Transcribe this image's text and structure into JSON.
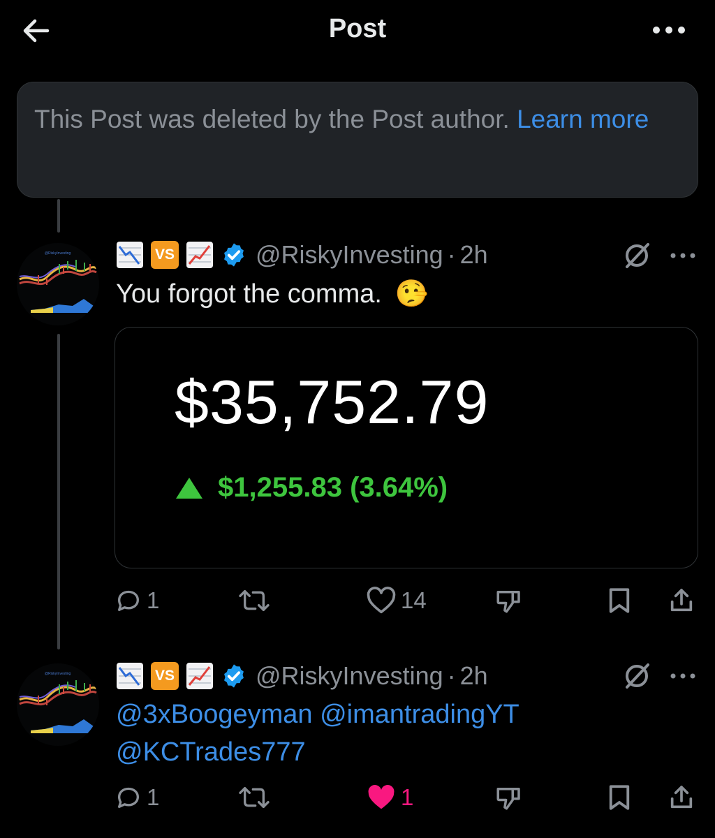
{
  "header": {
    "title": "Post"
  },
  "notice": {
    "text": "This Post was deleted by the Post author. ",
    "link": "Learn more"
  },
  "posts": [
    {
      "handle": "@RiskyInvesting",
      "sep": "·",
      "time": "2h",
      "badge": "VS",
      "text": "You forgot the comma.",
      "emoji": "🤥",
      "card": {
        "price": "$35,752.79",
        "change": "$1,255.83 (3.64%)"
      },
      "replies": "1",
      "reposts": "",
      "likes": "14",
      "liked": false
    },
    {
      "handle": "@RiskyInvesting",
      "sep": "·",
      "time": "2h",
      "badge": "VS",
      "mention1": "@3xBoogeyman",
      "mention2": "@imantradingYT",
      "mention3": "@KCTrades777",
      "replies": "1",
      "reposts": "",
      "likes": "1",
      "liked": true
    }
  ],
  "colors": {
    "accent": "#3d8ee6",
    "gain": "#3ec53e",
    "like": "#f91880",
    "verified": "#1d9bf0"
  }
}
